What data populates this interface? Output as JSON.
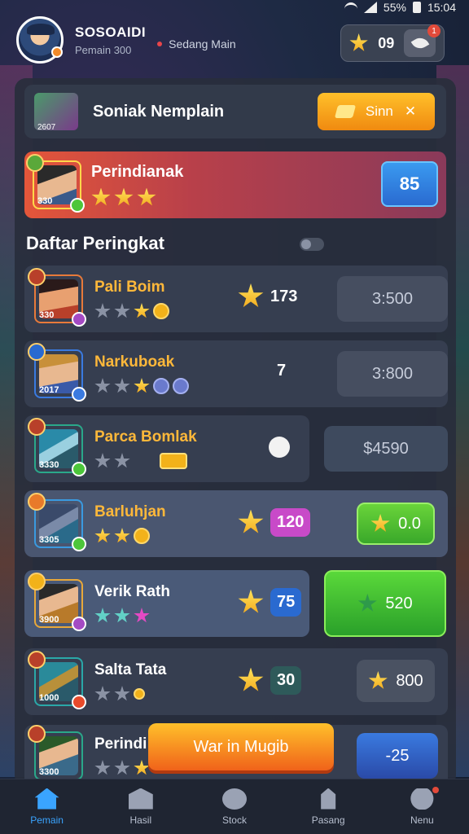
{
  "status_bar": {
    "battery": "55%",
    "time": "15:04"
  },
  "header": {
    "username": "SOSOAIDI",
    "subtitle": "Pemain 300",
    "status": "Sedang Main",
    "coins": "09",
    "notification_count": "1"
  },
  "banner": {
    "title": "Soniak Nemplain",
    "button_label": "Sinn"
  },
  "featured": {
    "name": "Perindianak",
    "level": "330",
    "stars": 3,
    "value": "85"
  },
  "section_title": "Daftar Peringkat",
  "leaderboard": [
    {
      "name": "Pali Boim",
      "level": "330",
      "stars_filled": 1,
      "stars_empty": 2,
      "score": "173",
      "action": "3:500"
    },
    {
      "name": "Narkuboak",
      "level": "2017",
      "stars_filled": 1,
      "stars_empty": 2,
      "score": "7",
      "action": "3:800"
    },
    {
      "name": "Parca Bomlak",
      "level": "3330",
      "stars_filled": 0,
      "stars_empty": 2,
      "score": "",
      "action": "$4590"
    },
    {
      "name": "Barluhjan",
      "level": "3305",
      "stars_filled": 2,
      "stars_empty": 0,
      "score": "120",
      "action": "0.0"
    },
    {
      "name": "Verik Rath",
      "level": "3900",
      "stars_filled": 0,
      "stars_empty": 0,
      "score": "75",
      "action": "520"
    },
    {
      "name": "Salta Tata",
      "level": "1000",
      "stars_filled": 0,
      "stars_empty": 2,
      "score": "30",
      "action": "800"
    },
    {
      "name": "Perindi",
      "level": "3300",
      "stars_filled": 1,
      "stars_empty": 2,
      "score": "",
      "action": "-25"
    }
  ],
  "cta_label": "War in Mugib",
  "nav": [
    {
      "label": "Pemain",
      "icon": "home-icon",
      "active": true
    },
    {
      "label": "Hasil",
      "icon": "building-icon",
      "active": false
    },
    {
      "label": "Stock",
      "icon": "globe-icon",
      "active": false
    },
    {
      "label": "Pasang",
      "icon": "windmill-icon",
      "active": false
    },
    {
      "label": "Nenu",
      "icon": "user-icon",
      "active": false
    }
  ],
  "colors": {
    "accent_blue": "#3aa4ff",
    "gold": "#f2b21a",
    "green": "#4cc63a",
    "orange": "#f08a10"
  }
}
